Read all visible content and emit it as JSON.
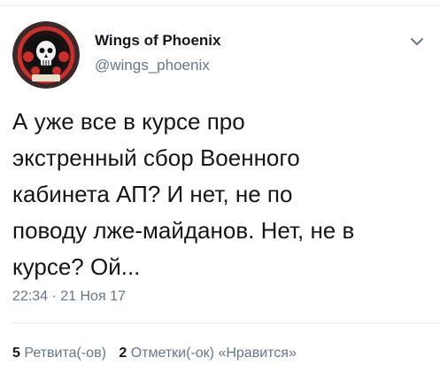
{
  "author": {
    "display_name": "Wings of Phoenix",
    "handle": "@wings_phoenix"
  },
  "tweet": {
    "lines": [
      "А уже все в курсе про",
      "экстренный сбор Военного",
      "кабинета АП? И нет, не по",
      "поводу лже-майданов. Нет, не в",
      "курсе? Ой..."
    ],
    "timestamp": "22:34 · 21 Ноя 17"
  },
  "stats": {
    "retweets_count": "5",
    "retweets_label": "Ретвита(-ов)",
    "likes_count": "2",
    "likes_label": "Отметки(-ок) «Нравится»"
  },
  "icons": {
    "menu": "chevron-down-icon"
  },
  "colors": {
    "text": "#14171a",
    "secondary": "#657786",
    "divider": "#e6ecf0"
  }
}
